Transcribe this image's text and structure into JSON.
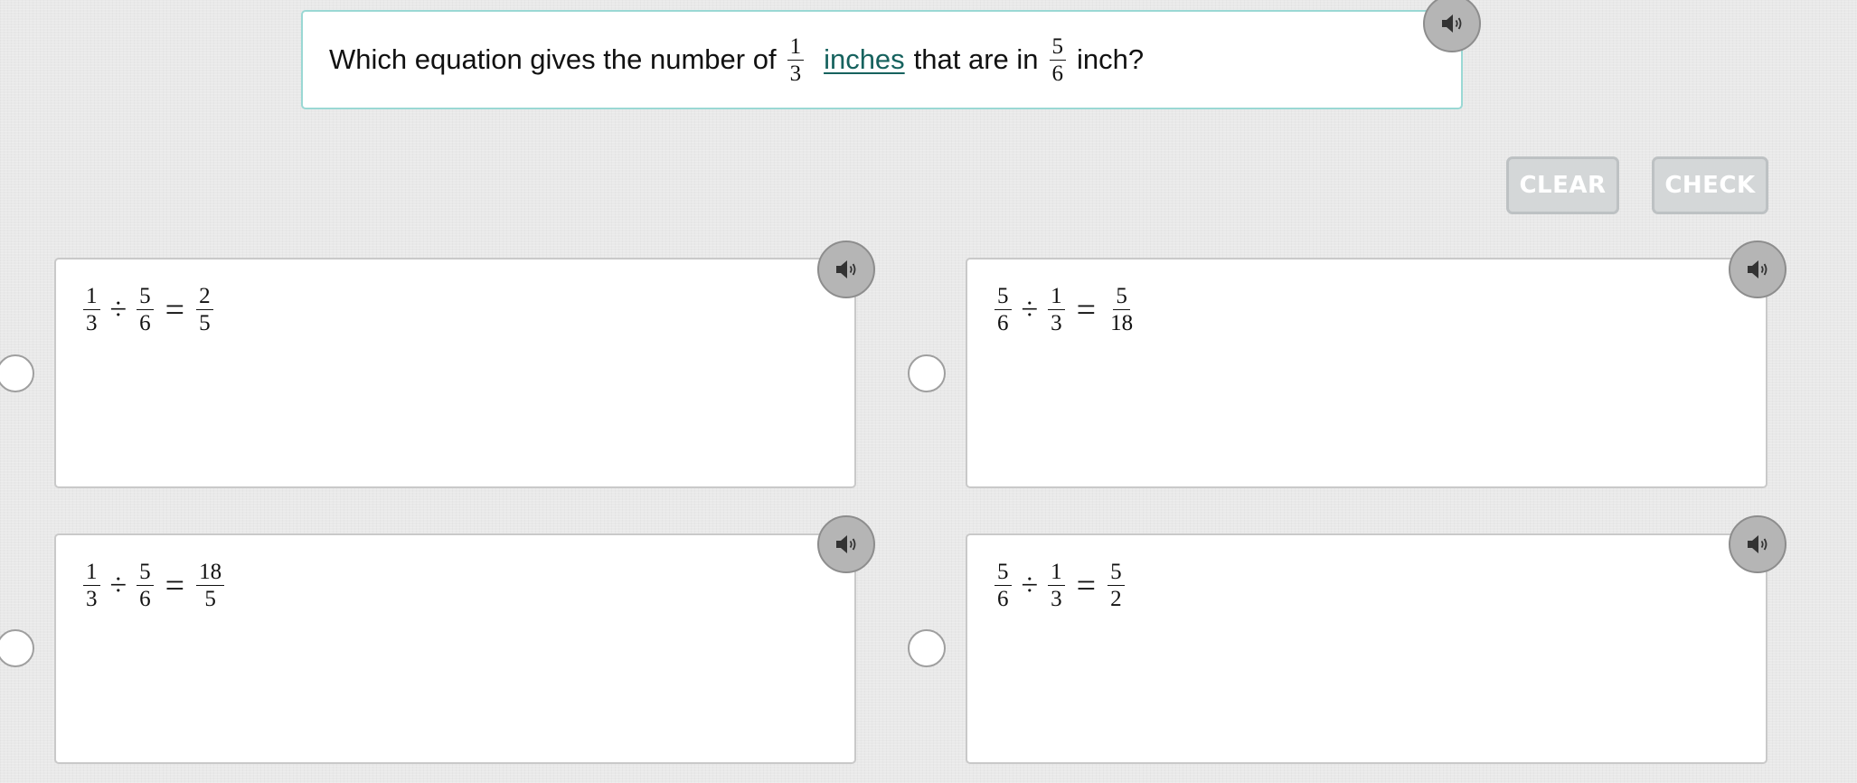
{
  "question": {
    "prefix": "Which equation gives the number of",
    "frac1": {
      "num": "1",
      "den": "3"
    },
    "link": "inches",
    "middle": "that are in",
    "frac2": {
      "num": "5",
      "den": "6"
    },
    "suffix": "inch?"
  },
  "buttons": {
    "clear": "CLEAR",
    "check": "CHECK"
  },
  "options": [
    {
      "a": {
        "num": "1",
        "den": "3"
      },
      "op": "÷",
      "b": {
        "num": "5",
        "den": "6"
      },
      "eq": "=",
      "r": {
        "num": "2",
        "den": "5"
      }
    },
    {
      "a": {
        "num": "5",
        "den": "6"
      },
      "op": "÷",
      "b": {
        "num": "1",
        "den": "3"
      },
      "eq": "=",
      "r": {
        "num": "5",
        "den": "18"
      }
    },
    {
      "a": {
        "num": "1",
        "den": "3"
      },
      "op": "÷",
      "b": {
        "num": "5",
        "den": "6"
      },
      "eq": "=",
      "r": {
        "num": "18",
        "den": "5"
      }
    },
    {
      "a": {
        "num": "5",
        "den": "6"
      },
      "op": "÷",
      "b": {
        "num": "1",
        "den": "3"
      },
      "eq": "=",
      "r": {
        "num": "5",
        "den": "2"
      }
    }
  ],
  "icons": {
    "speaker": "speaker-icon"
  },
  "colors": {
    "background": "#e9e9e9",
    "question_border": "#9ad8d4",
    "link": "#16625e",
    "button_fill": "#d4d7d8",
    "speaker_fill": "#b5b5b5"
  }
}
